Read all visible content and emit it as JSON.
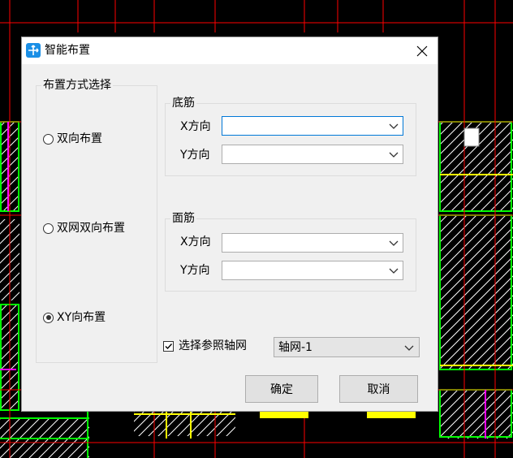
{
  "window": {
    "title": "智能布置"
  },
  "layout_group": {
    "legend": "布置方式选择",
    "options": [
      {
        "label": "双向布置",
        "checked": false
      },
      {
        "label": "双网双向布置",
        "checked": false
      },
      {
        "label": "XY向布置",
        "checked": true
      }
    ]
  },
  "bottom_rebar": {
    "legend": "底筋",
    "x_label": "X方向",
    "y_label": "Y方向",
    "x_value": "",
    "y_value": ""
  },
  "top_rebar": {
    "legend": "面筋",
    "x_label": "X方向",
    "y_label": "Y方向",
    "x_value": "",
    "y_value": ""
  },
  "grid_ref": {
    "checkbox_label": "选择参照轴网",
    "checked": true,
    "selected": "轴网-1"
  },
  "buttons": {
    "ok": "确定",
    "cancel": "取消"
  },
  "colors": {
    "cad_background": "#000000",
    "grid_red": "#ff0000",
    "wall_green": "#00ff00",
    "highlight_yellow": "#ffff00",
    "magenta": "#ff00ff",
    "accent_blue": "#0078d7"
  }
}
